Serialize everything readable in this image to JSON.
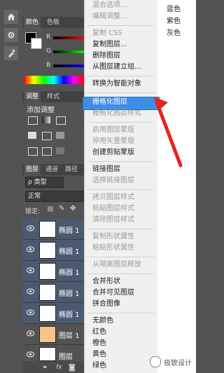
{
  "toolbar_icons": [
    "home-icon",
    "gear-icon",
    "brush-icon"
  ],
  "color_panel": {
    "tabs": [
      "颜色",
      "色板"
    ],
    "channels": [
      "R",
      "G",
      "B"
    ]
  },
  "adjust_panel": {
    "tabs": [
      "调整",
      "样式"
    ],
    "title": "添加调整"
  },
  "layers_panel": {
    "tabs": [
      "图层",
      "通道",
      "路径"
    ],
    "filter_label": "ρ 类型",
    "blend_mode": "正常",
    "lock_label": "锁定:",
    "layers": [
      {
        "name": "椭圆 1",
        "selected": true
      },
      {
        "name": "椭圆 1",
        "selected": true
      },
      {
        "name": "椭圆 1",
        "selected": true
      },
      {
        "name": "椭圆 1",
        "selected": true
      },
      {
        "name": "椭圆 1",
        "selected": true
      },
      {
        "name": "图层 1",
        "selected": false
      },
      {
        "name": "图层",
        "selected": false
      }
    ]
  },
  "menu": {
    "items": [
      {
        "label": "混合选项...",
        "disabled": true
      },
      {
        "label": "编辑调整...",
        "disabled": true
      },
      {
        "label": "复制 CSS",
        "disabled": true
      },
      {
        "label": "复制图层...",
        "disabled": false
      },
      {
        "label": "删除图层",
        "disabled": false
      },
      {
        "label": "从图层建立组...",
        "disabled": false
      },
      {
        "label": "转换为智能对象",
        "disabled": false
      },
      {
        "label": "栅格化图层",
        "disabled": false,
        "highlighted": true
      },
      {
        "label": "栅格化图层样式",
        "disabled": true
      },
      {
        "label": "启用图层蒙版",
        "disabled": true
      },
      {
        "label": "停用矢量蒙版",
        "disabled": true
      },
      {
        "label": "创建剪贴蒙版",
        "disabled": false
      },
      {
        "label": "链接图层",
        "disabled": false
      },
      {
        "label": "选择链接图层",
        "disabled": true
      },
      {
        "label": "拷贝图层样式",
        "disabled": true
      },
      {
        "label": "粘贴图层样式",
        "disabled": true
      },
      {
        "label": "清除图层样式",
        "disabled": true
      },
      {
        "label": "复制形状属性",
        "disabled": true
      },
      {
        "label": "粘贴形状属性",
        "disabled": true
      },
      {
        "label": "从隔离图层释放",
        "disabled": true
      },
      {
        "label": "合并形状",
        "disabled": false
      },
      {
        "label": "合并可见图层",
        "disabled": false
      },
      {
        "label": "拼合图像",
        "disabled": false
      },
      {
        "label": "无颜色",
        "disabled": false
      },
      {
        "label": "红色",
        "disabled": false
      },
      {
        "label": "橙色",
        "disabled": false
      },
      {
        "label": "黄色",
        "disabled": false
      },
      {
        "label": "绿色",
        "disabled": false
      }
    ]
  },
  "color_labels": [
    "蓝色",
    "紫色",
    "灰色"
  ],
  "watermark": "极致设计"
}
